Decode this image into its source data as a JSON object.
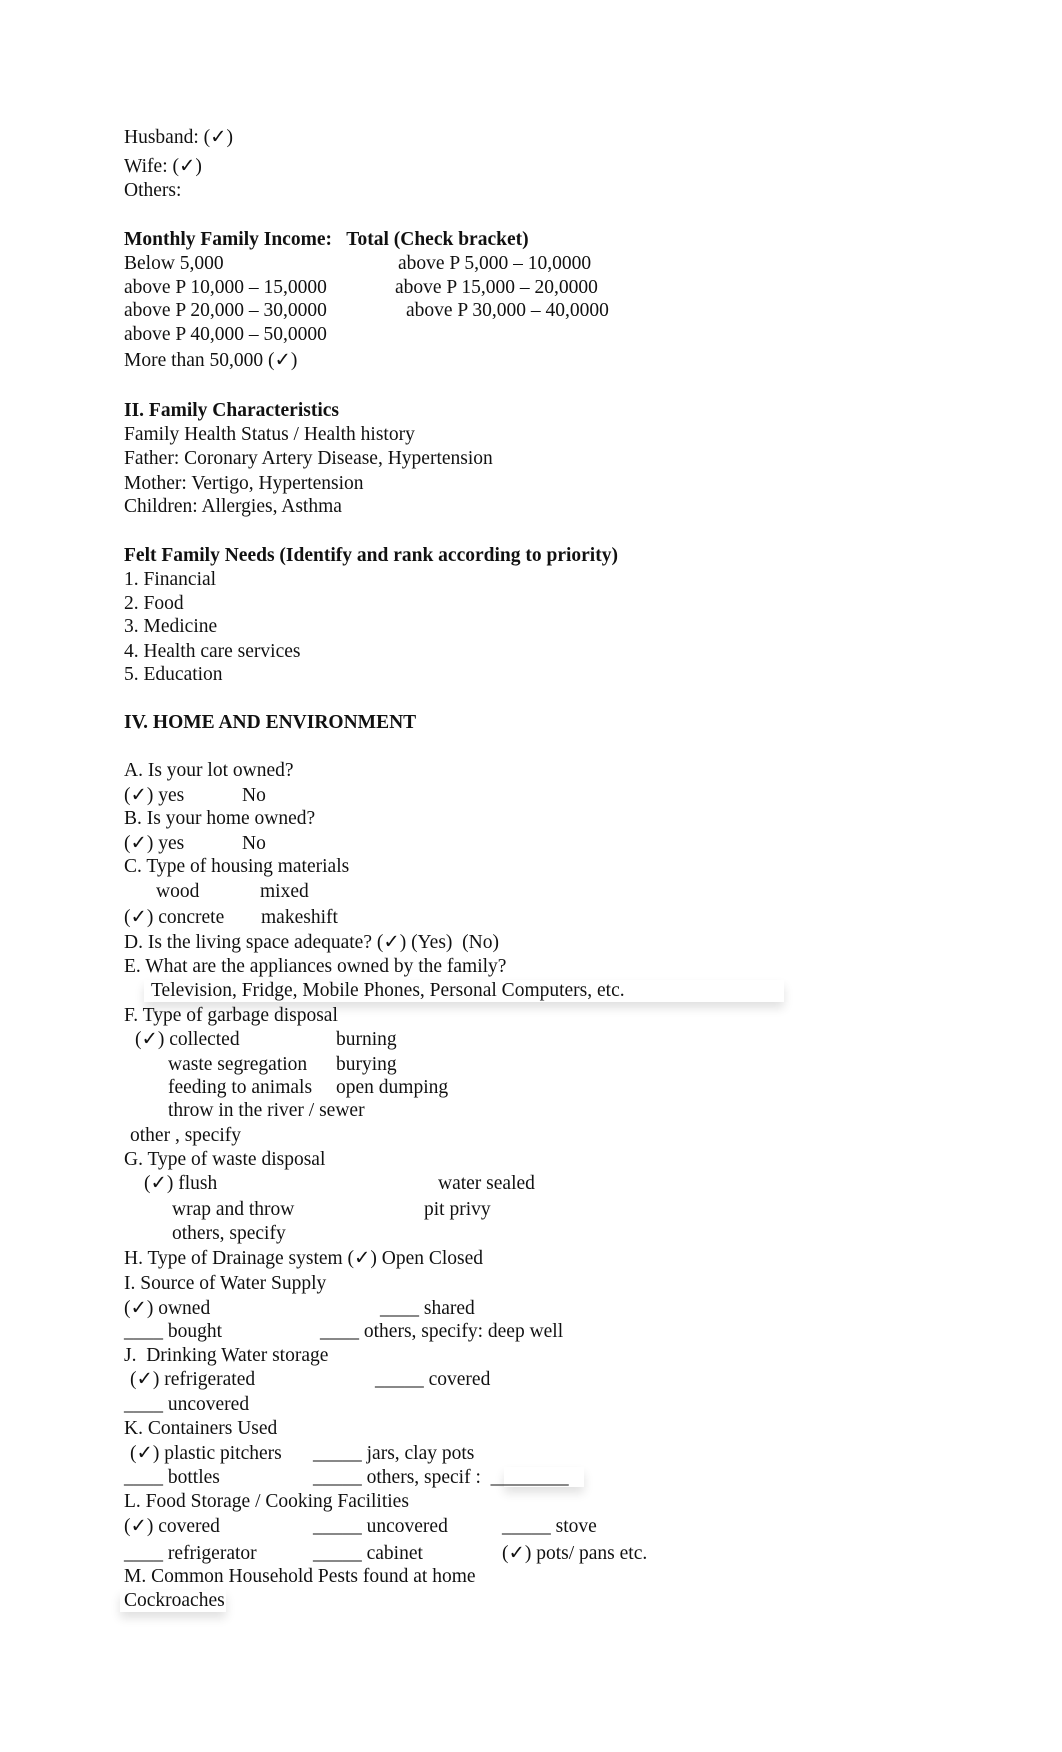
{
  "earners": {
    "husband": "Husband: (✓)",
    "wife": "Wife: (✓)",
    "others": "Others:"
  },
  "income": {
    "heading": "Monthly Family Income:   Total (Check bracket)",
    "brackets": [
      "Below 5,000",
      "above P 5,000 – 10,0000",
      "above P 10,000 – 15,0000",
      "above P 15,000 – 20,0000",
      "above P 20,000 – 30,0000",
      "above P 30,000 – 40,0000",
      "above P 40,000 – 50,0000",
      "More than 50,000 (✓)"
    ],
    "selected": "More than 50,000"
  },
  "family_characteristics": {
    "heading": "II. Family Characteristics",
    "subheading": "Family Health Status / Health history",
    "father": "Father: Coronary Artery Disease, Hypertension",
    "mother": "Mother: Vertigo, Hypertension",
    "children": "Children: Allergies, Asthma"
  },
  "felt_needs": {
    "heading": "Felt Family Needs (Identify and rank according to priority)",
    "items": [
      "1. Financial",
      "2. Food",
      "3. Medicine",
      "4. Health care services",
      "5. Education"
    ]
  },
  "home": {
    "heading": "IV. HOME AND ENVIRONMENT",
    "A": {
      "q": "A. Is your lot owned?",
      "yes": "(✓) yes",
      "no": "No"
    },
    "B": {
      "q": "B. Is your home owned?",
      "yes": "(✓) yes",
      "no": "No"
    },
    "C": {
      "q": "C. Type of housing materials",
      "wood": "wood",
      "mixed": "mixed",
      "concrete": "(✓) concrete",
      "makeshift": "makeshift"
    },
    "D": {
      "q": "D. Is the living space adequate? (✓) (Yes)  (No)"
    },
    "E": {
      "q": "E. What are the appliances owned by the family?",
      "answer": "Television, Fridge, Mobile Phones, Personal Computers, etc."
    },
    "F": {
      "q": "F. Type of garbage disposal",
      "collected": "(✓) collected",
      "burning": "burning",
      "segregation": "waste segregation",
      "burying": "burying",
      "feeding": "feeding to animals",
      "dumping": "open dumping",
      "river": "throw in the river / sewer",
      "other": "other , specify"
    },
    "G": {
      "q": "G. Type of waste disposal",
      "flush": "(✓) flush",
      "water_sealed": "water sealed",
      "wrap": "wrap and throw",
      "pit": "pit privy",
      "others": "others, specify"
    },
    "H": {
      "q": "H. Type of Drainage system (✓) Open Closed"
    },
    "I": {
      "q": "I. Source of Water Supply",
      "owned": "(✓) owned",
      "shared": "____ shared",
      "bought": "____ bought",
      "others": "____ others, specify: deep well"
    },
    "J": {
      "q": "J.  Drinking Water storage",
      "refrigerated": "(✓) refrigerated",
      "covered": "_____ covered",
      "uncovered": "____ uncovered"
    },
    "K": {
      "q": "K. Containers Used",
      "plastic": "(✓) plastic pitchers",
      "jars": "_____ jars, clay pots",
      "bottles": "____ bottles",
      "others": "_____ others, specif :  ________"
    },
    "L": {
      "q": "L. Food Storage / Cooking Facilities",
      "covered": "(✓) covered",
      "uncovered": "_____ uncovered",
      "stove": "_____ stove",
      "refrigerator": "____ refrigerator",
      "cabinet": "_____ cabinet",
      "pots": "(✓) pots/ pans etc."
    },
    "M": {
      "q": "M. Common Household Pests found at home",
      "answer": "Cockroaches"
    }
  }
}
